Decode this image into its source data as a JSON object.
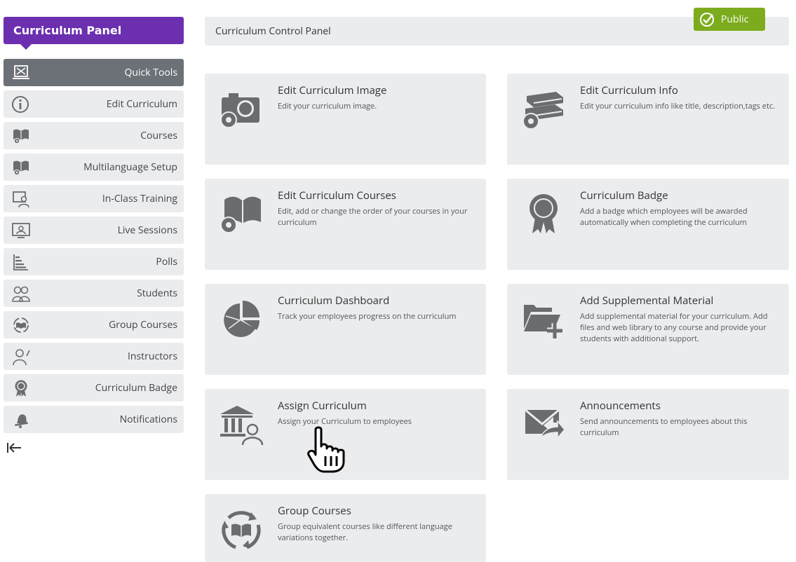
{
  "sidebar": {
    "title": "Curriculum Panel",
    "items": [
      {
        "label": "Quick Tools",
        "icon": "quick-tools-icon"
      },
      {
        "label": "Edit Curriculum",
        "icon": "info-icon"
      },
      {
        "label": "Courses",
        "icon": "courses-icon"
      },
      {
        "label": "Multilanguage Setup",
        "icon": "multilanguage-icon"
      },
      {
        "label": "In-Class Training",
        "icon": "in-class-training-icon"
      },
      {
        "label": "Live Sessions",
        "icon": "live-sessions-icon"
      },
      {
        "label": "Polls",
        "icon": "polls-icon"
      },
      {
        "label": "Students",
        "icon": "students-icon"
      },
      {
        "label": "Group Courses",
        "icon": "group-courses-icon"
      },
      {
        "label": "Instructors",
        "icon": "instructors-icon"
      },
      {
        "label": "Curriculum Badge",
        "icon": "badge-icon"
      },
      {
        "label": "Notifications",
        "icon": "bell-icon"
      }
    ]
  },
  "topbar": {
    "title": "Curriculum Control Panel",
    "public_label": "Public"
  },
  "cards": [
    {
      "title": "Edit Curriculum Image",
      "desc": "Edit your curriculum image.",
      "icon": "camera-gear-icon"
    },
    {
      "title": "Edit Curriculum Info",
      "desc": "Edit your curriculum info like title, description,tags etc.",
      "icon": "books-gear-icon"
    },
    {
      "title": "Edit Curriculum Courses",
      "desc": "Edit, add or change the order of your courses in your curriculum",
      "icon": "open-book-gear-icon"
    },
    {
      "title": "Curriculum Badge",
      "desc": "Add a badge which employees will be awarded automatically when completing the curriculum",
      "icon": "award-ribbon-icon"
    },
    {
      "title": "Curriculum Dashboard",
      "desc": "Track your employees progress on the curriculum",
      "icon": "pie-chart-icon"
    },
    {
      "title": "Add Supplemental Material",
      "desc": "Add supplemental material for your curriculum. Add files and web library to any course and provide your students with additional support.",
      "icon": "folder-plus-icon"
    },
    {
      "title": "Assign Curriculum",
      "desc": "Assign your Curriculum to employees",
      "icon": "institution-user-icon"
    },
    {
      "title": "Announcements",
      "desc": "Send announcements to employees about this curriculum",
      "icon": "envelope-forward-icon"
    },
    {
      "title": "Group Courses",
      "desc": "Group equivalent courses like different language variations together.",
      "icon": "book-cycle-icon"
    }
  ],
  "colors": {
    "accent_purple": "#6b2fb0",
    "public_green": "#7cac1d",
    "active_item": "#6c7077",
    "card_bg": "#ebecee",
    "icon_gray": "#6a6c70"
  }
}
